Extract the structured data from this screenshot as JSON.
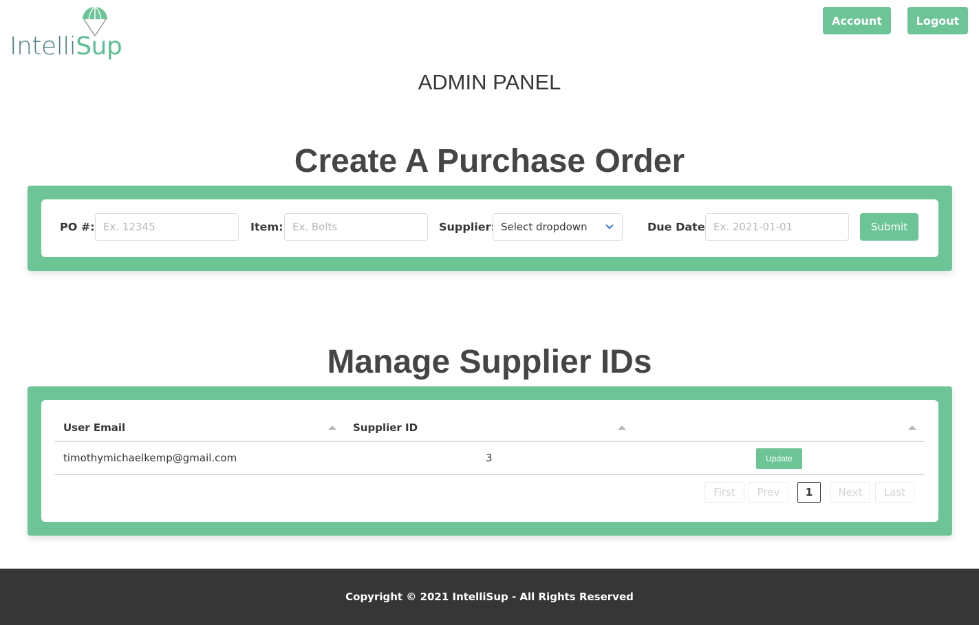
{
  "brand": {
    "logo_part1": "Intelli",
    "logo_part2": "Sup",
    "accent": "#6cc497"
  },
  "nav": {
    "account_label": "Account",
    "logout_label": "Logout"
  },
  "page": {
    "admin_title": "ADMIN PANEL"
  },
  "purchase_order": {
    "title": "Create A Purchase Order",
    "po_label": "PO #:",
    "po_placeholder": "Ex. 12345",
    "item_label": "Item:",
    "item_placeholder": "Ex. Bolts",
    "supplier_label": "Supplier:",
    "supplier_selected": "Select dropdown",
    "due_label": "Due Date:",
    "due_placeholder": "Ex. 2021-01-01",
    "submit_label": "Submit"
  },
  "suppliers": {
    "title": "Manage Supplier IDs",
    "columns": [
      "User Email",
      "Supplier ID",
      ""
    ],
    "rows": [
      {
        "email": "timothymichaelkemp@gmail.com",
        "supplier_id": "3",
        "action": "Update"
      }
    ],
    "pagination": {
      "first": "First",
      "prev": "Prev",
      "current": "1",
      "next": "Next",
      "last": "Last"
    }
  },
  "footer": {
    "copyright": "Copyright © 2021 IntelliSup - All Rights Reserved"
  }
}
